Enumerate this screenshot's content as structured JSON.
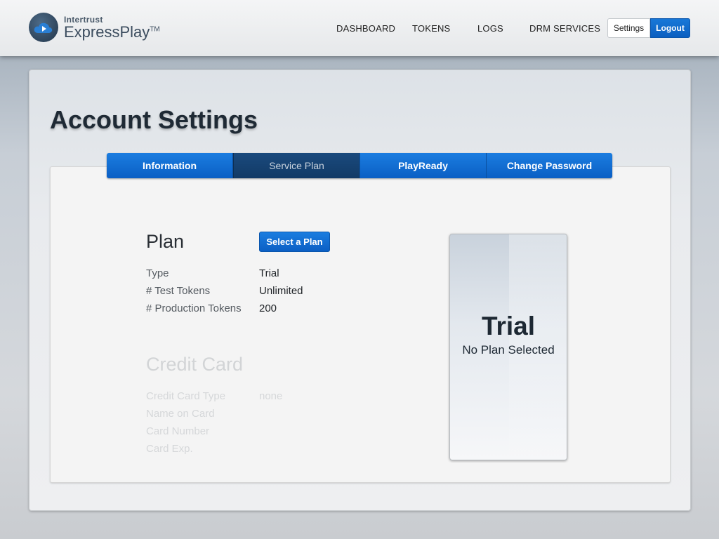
{
  "header": {
    "logo_small": "Intertrust",
    "logo_big": "ExpressPlay",
    "logo_tm": "TM",
    "nav": [
      "DASHBOARD",
      "TOKENS",
      "LOGS",
      "DRM SERVICES"
    ],
    "settings_label": "Settings",
    "logout_label": "Logout"
  },
  "page": {
    "title": "Account Settings"
  },
  "tabs": [
    {
      "label": "Information",
      "active": false
    },
    {
      "label": "Service Plan",
      "active": true
    },
    {
      "label": "PlayReady",
      "active": false
    },
    {
      "label": "Change Password",
      "active": false
    }
  ],
  "plan": {
    "heading": "Plan",
    "select_button": "Select a Plan",
    "rows": [
      {
        "label": "Type",
        "value": "Trial"
      },
      {
        "label": "# Test Tokens",
        "value": "Unlimited"
      },
      {
        "label": "# Production Tokens",
        "value": "200"
      }
    ]
  },
  "credit_card": {
    "heading": "Credit Card",
    "rows": [
      {
        "label": "Credit Card Type",
        "value": "none"
      },
      {
        "label": "Name on Card",
        "value": ""
      },
      {
        "label": "Card Number",
        "value": ""
      },
      {
        "label": "Card Exp.",
        "value": ""
      }
    ]
  },
  "plan_card": {
    "plan_name": "Trial",
    "subtitle": "No Plan Selected"
  },
  "colors": {
    "accent": "#0b63c6",
    "active_tab": "#163f6e",
    "title_text": "#1f2a35"
  },
  "icons": {
    "logo": "cloud-play-icon"
  }
}
